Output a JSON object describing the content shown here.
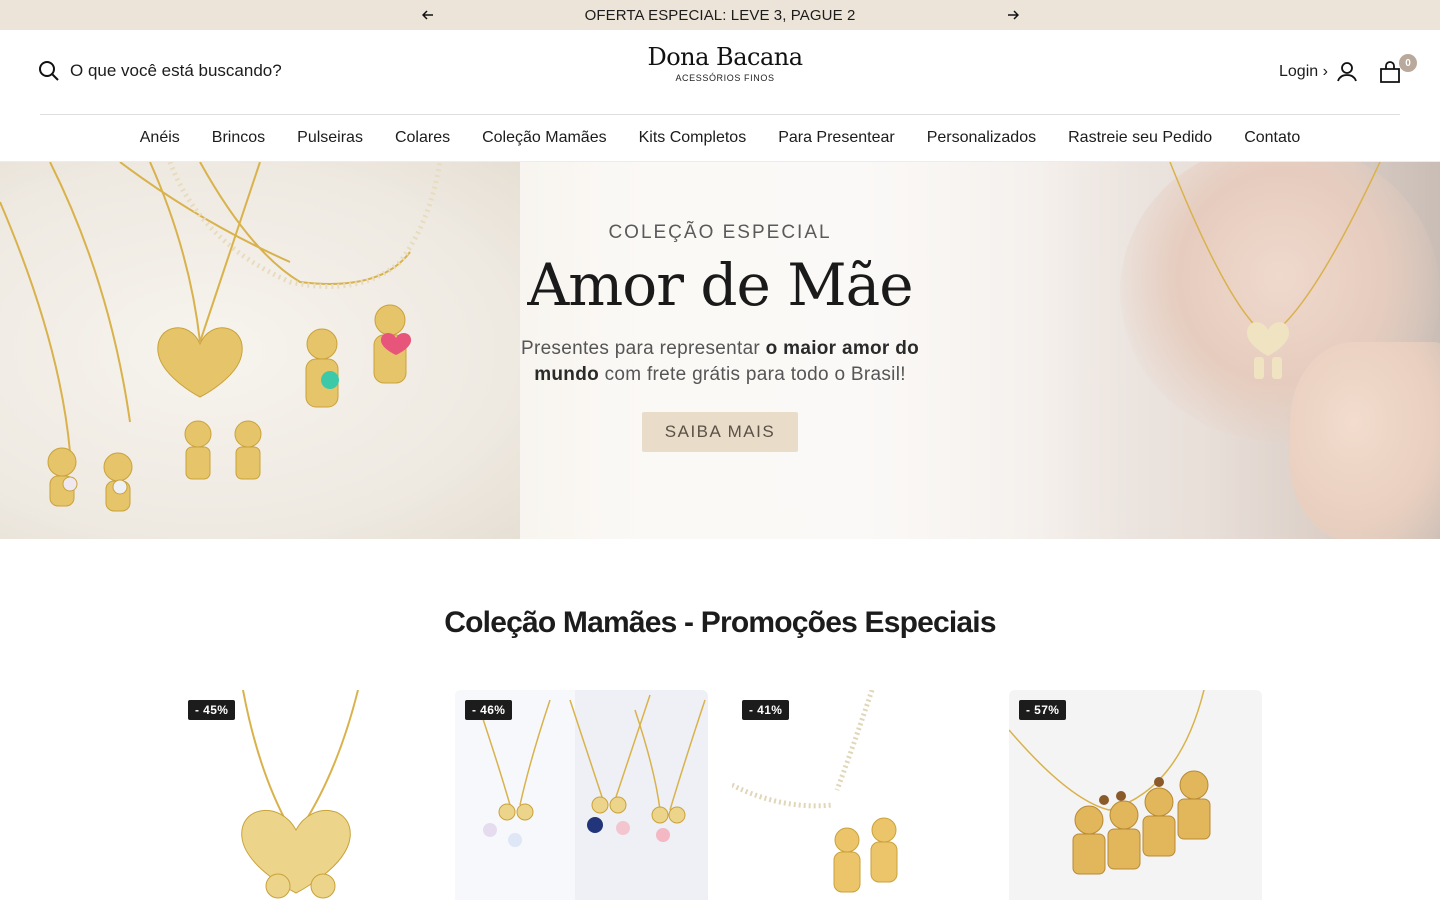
{
  "announcement": {
    "text": "OFERTA ESPECIAL: LEVE 3, PAGUE 2"
  },
  "header": {
    "search_label": "O que você está buscando?",
    "logo_name": "Dona Bacana",
    "logo_sub": "ACESSÓRIOS FINOS",
    "login_label": "Login ›",
    "cart_count": "0"
  },
  "nav": {
    "items": [
      "Anéis",
      "Brincos",
      "Pulseiras",
      "Colares",
      "Coleção Mamães",
      "Kits Completos",
      "Para Presentear",
      "Personalizados",
      "Rastreie seu Pedido",
      "Contato"
    ]
  },
  "hero": {
    "eyebrow": "COLEÇÃO ESPECIAL",
    "title": "Amor de Mãe",
    "subtitle_part1": "Presentes para representar ",
    "subtitle_bold1": "o maior amor do",
    "subtitle_bold2": "mundo",
    "subtitle_part2": " com frete grátis para todo o Brasil!",
    "button_label": "SAIBA MAIS"
  },
  "section": {
    "title": "Coleção Mamães - Promoções Especiais"
  },
  "products": [
    {
      "badge": "- 45%"
    },
    {
      "badge": "- 46%"
    },
    {
      "badge": "- 41%"
    },
    {
      "badge": "- 57%"
    }
  ],
  "colors": {
    "announcement_bg": "#ece4d8",
    "button_bg": "#e9dcc9",
    "badge_bg": "#1c1c1c",
    "gold": "#d9b24c"
  }
}
